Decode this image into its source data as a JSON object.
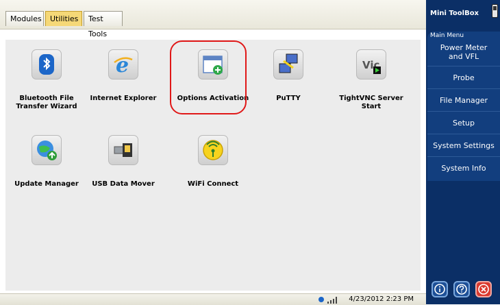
{
  "tabs": [
    {
      "label": "Modules"
    },
    {
      "label": "Utilities"
    },
    {
      "label": "Test Tools"
    }
  ],
  "apps": [
    {
      "label": "Bluetooth File\nTransfer Wizard",
      "icon": "bluetooth-icon"
    },
    {
      "label": "Internet Explorer",
      "icon": "internet-explorer-icon"
    },
    {
      "label": "Options Activation",
      "icon": "options-activation-icon"
    },
    {
      "label": "PuTTY",
      "icon": "putty-icon"
    },
    {
      "label": "TightVNC Server\nStart",
      "icon": "tightvnc-icon"
    },
    {
      "label": "Update Manager",
      "icon": "update-manager-icon"
    },
    {
      "label": "USB Data Mover",
      "icon": "usb-data-mover-icon"
    },
    {
      "label": "WiFi Connect",
      "icon": "wifi-icon"
    }
  ],
  "sidebar": {
    "title": "Mini ToolBox",
    "menu_header": "Main Menu",
    "items": [
      {
        "label": "Power Meter\nand VFL"
      },
      {
        "label": "Probe"
      },
      {
        "label": "File Manager"
      },
      {
        "label": "Setup"
      },
      {
        "label": "System Settings"
      },
      {
        "label": "System Info"
      }
    ]
  },
  "status": {
    "datetime": "4/23/2012 2:23 PM"
  },
  "colors": {
    "sidebar_bg": "#0b2f66",
    "highlight": "#e01717",
    "active_tab": "#f5d877"
  }
}
